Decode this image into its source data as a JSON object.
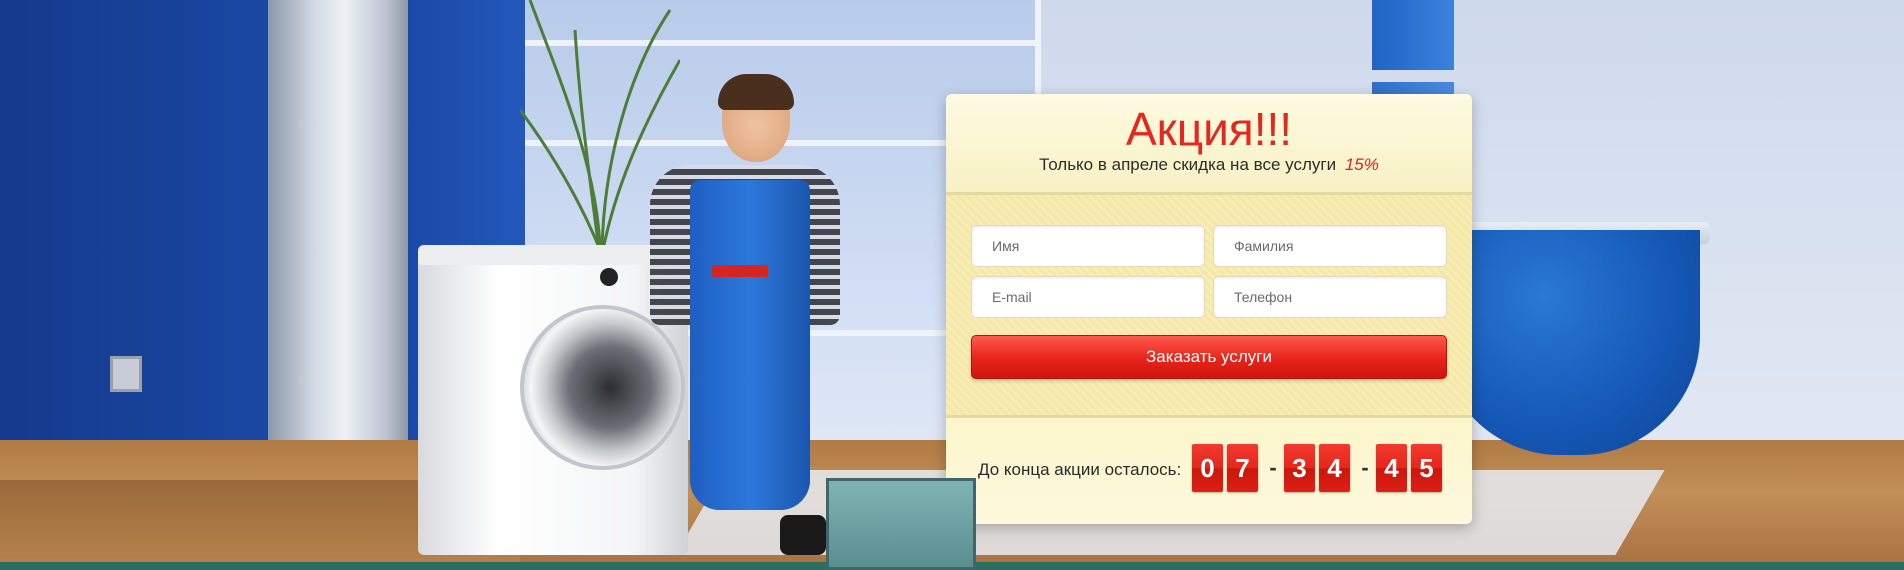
{
  "promo": {
    "title": "Акция!!!",
    "subtitle": "Только в апреле скидка на все услуги",
    "discount": "15%"
  },
  "form": {
    "first_name_placeholder": "Имя",
    "last_name_placeholder": "Фамилия",
    "email_placeholder": "E-mail",
    "phone_placeholder": "Телефон",
    "submit_label": "Заказать услуги"
  },
  "timer": {
    "label": "До конца акции осталось:",
    "hours": [
      "0",
      "7"
    ],
    "minutes": [
      "3",
      "4"
    ],
    "seconds": [
      "4",
      "5"
    ],
    "separator": "-"
  },
  "colors": {
    "accent_red": "#e3281f",
    "card_bg": "#fbf6c8"
  }
}
